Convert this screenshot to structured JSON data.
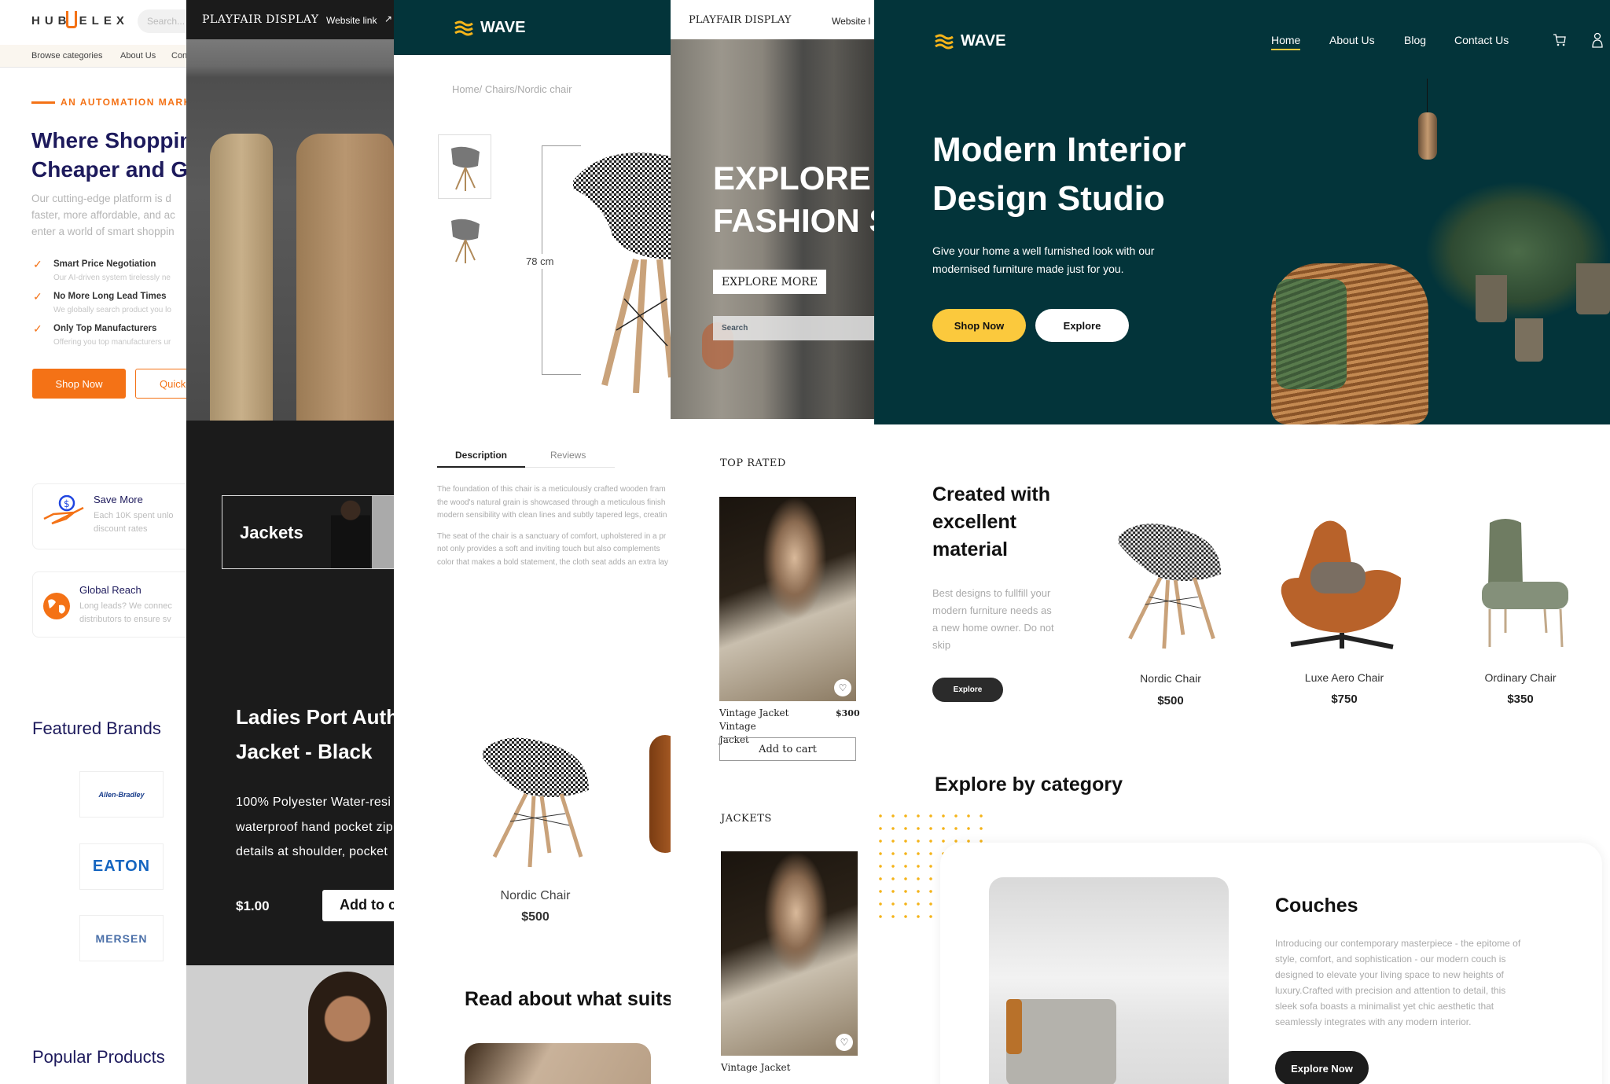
{
  "hubelex": {
    "logo": "HUB ELEX",
    "search_placeholder": "Search...",
    "nav": [
      "Browse categories",
      "About Us",
      "Con"
    ],
    "tagline": "AN AUTOMATION MARK",
    "heading_lines": [
      "Where Shoppin",
      "Cheaper and G"
    ],
    "paragraph_lines": [
      "Our cutting-edge platform is d",
      "faster, more affordable, and ac",
      "enter a world of smart shoppin"
    ],
    "features": [
      {
        "title": "Smart Price Negotiation",
        "desc": "Our AI-driven system tirelessly ne"
      },
      {
        "title": "No More Long Lead Times",
        "desc": "We globally search product you lo"
      },
      {
        "title": "Only Top Manufacturers",
        "desc": "Offering you top manufacturers ur"
      }
    ],
    "shop_now": "Shop Now",
    "quick": "Quick",
    "cards": [
      {
        "title": "Save More",
        "lines": [
          "Each 10K spent unlo",
          "discount rates"
        ],
        "icon": "money-hand-icon"
      },
      {
        "title": "Global Reach",
        "lines": [
          "Long leads? We connec",
          "distributors to ensure sv"
        ],
        "icon": "globe-icon"
      }
    ],
    "featured_brands": "Featured Brands",
    "brands": [
      "Allen-Bradley",
      "EATON",
      "MERSEN"
    ],
    "popular_products": "Popular Products",
    "colors": {
      "accent": "#f47216",
      "navy": "#1d1a5c"
    }
  },
  "playfair_fashion": {
    "brand": "PLAYFAIR DISPLAY",
    "website_link": "Website link",
    "category_card": "Jackets",
    "product_title_lines": [
      "Ladies Port Auth",
      "Jacket - Black"
    ],
    "desc_lines": [
      "100% Polyester  Water-resi",
      "waterproof hand pocket zip",
      "details at shoulder, pocket"
    ],
    "price": "$1.00",
    "add_to_cart": "Add to c"
  },
  "wave_product": {
    "logo": "WAVE",
    "breadcrumb": "Home/ Chairs/Nordic chair",
    "dimension": "78 cm",
    "tabs": [
      "Description",
      "Reviews"
    ],
    "active_tab": "Description",
    "desc_para1": [
      "The foundation of this chair is a meticulously crafted wooden fram",
      "the wood's natural grain is showcased through a meticulous finish",
      "modern sensibility with clean lines and subtly tapered legs, creatin"
    ],
    "desc_para2": [
      "The seat of the chair is a sanctuary of comfort, upholstered in a pr",
      "not only provides a soft and inviting touch but also complements",
      "color that makes a bold statement, the cloth seat adds an extra lay"
    ],
    "related": {
      "name": "Nordic Chair",
      "price": "$500"
    },
    "read_heading": "Read about what suits"
  },
  "playfair_shop": {
    "brand": "PLAYFAIR DISPLAY",
    "website_link": "Website l",
    "hero_lines": [
      "EXPLORE Y",
      "FASHION S"
    ],
    "explore_more": "EXPLORE MORE",
    "search_placeholder": "Search",
    "top_rated": "TOP RATED",
    "top_item": {
      "name_lines": [
        "Vintage Jacket Vintage",
        "Jacket"
      ],
      "price": "$300",
      "add_to_cart": "Add to cart"
    },
    "jackets": "JACKETS",
    "jacket_item": {
      "name": "Vintage Jacket"
    }
  },
  "wave_home": {
    "logo": "WAVE",
    "nav": [
      "Home",
      "About Us",
      "Blog",
      "Contact Us"
    ],
    "active_nav": "Home",
    "hero_lines": [
      "Modern Interior",
      "Design Studio"
    ],
    "hero_sub_lines": [
      "Give your home a well furnished look with our",
      "modernised furniture made just for you."
    ],
    "shop_now": "Shop Now",
    "explore": "Explore",
    "material_heading_lines": [
      "Created with",
      "excellent",
      "material"
    ],
    "material_desc_lines": [
      "Best designs to fullfill your",
      "modern furniture needs as",
      "a new home owner. Do not",
      "skip"
    ],
    "material_explore": "Explore",
    "products": [
      {
        "name": "Nordic Chair",
        "price": "$500"
      },
      {
        "name": "Luxe Aero Chair",
        "price": "$750"
      },
      {
        "name": "Ordinary Chair",
        "price": "$350"
      }
    ],
    "category_heading": "Explore by category",
    "category": {
      "title": "Couches",
      "desc_lines": [
        "Introducing our contemporary masterpiece - the epitome of",
        "style, comfort, and sophistication - our modern couch is",
        "designed to elevate your living space to new heights of",
        "luxury.Crafted with precision and attention to detail, this",
        "sleek sofa boasts a minimalist yet chic aesthetic that",
        "seamlessly integrates with any modern interior."
      ],
      "button": "Explore Now"
    },
    "colors": {
      "primary": "#03343a",
      "accent": "#fbc93d",
      "dark_button": "#1c1c1c"
    }
  }
}
